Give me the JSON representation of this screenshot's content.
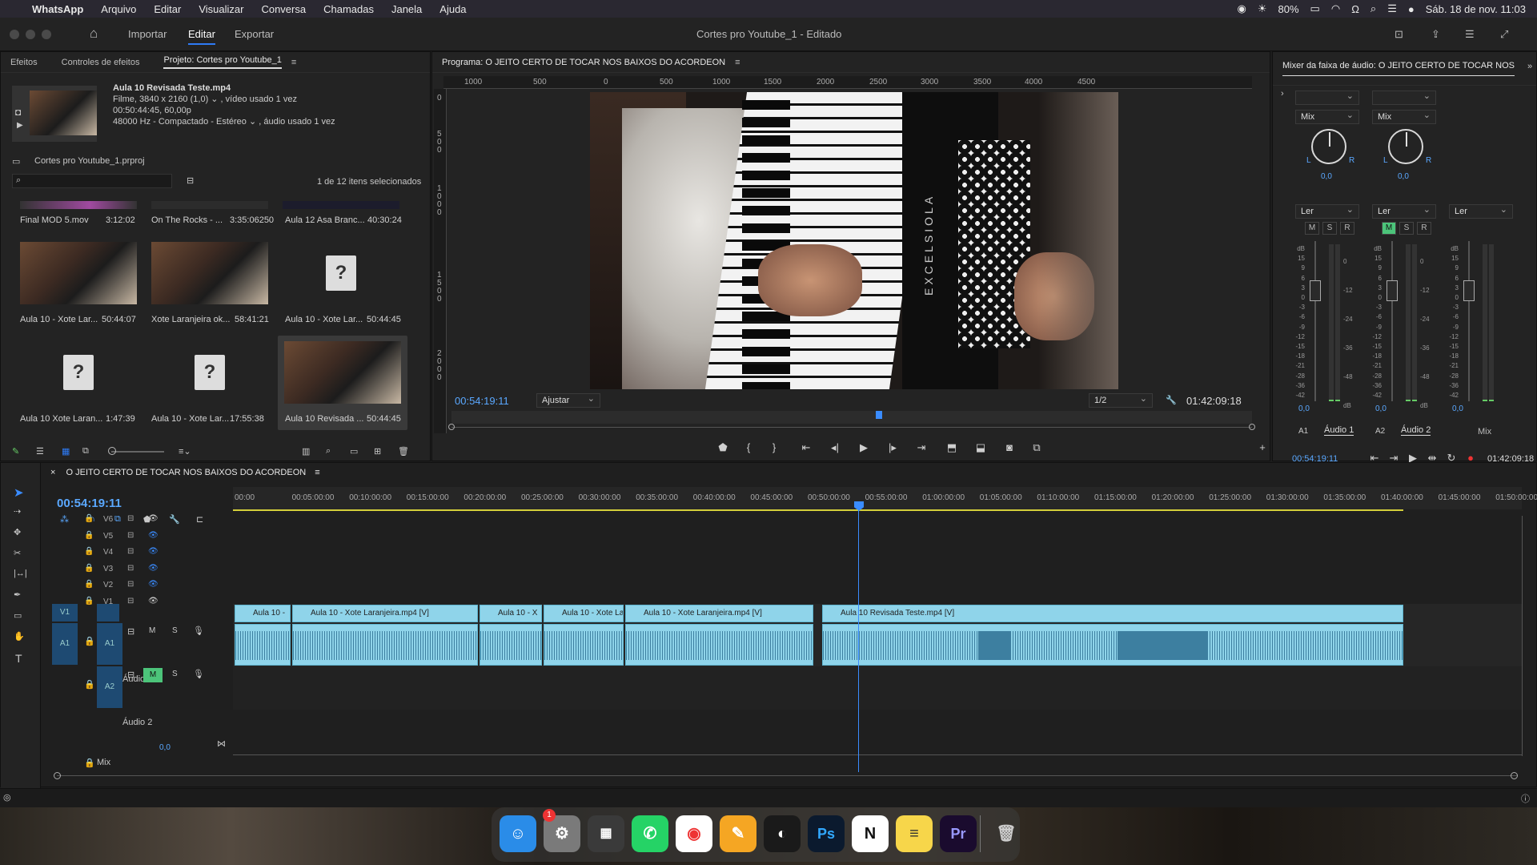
{
  "menubar": {
    "app": "WhatsApp",
    "items": [
      "Arquivo",
      "Editar",
      "Visualizar",
      "Conversa",
      "Chamadas",
      "Janela",
      "Ajuda"
    ],
    "battery": "80%",
    "datetime": "Sáb. 18 de nov.  11:03"
  },
  "appbar": {
    "tabs": [
      "Importar",
      "Editar",
      "Exportar"
    ],
    "active_tab": "Editar",
    "title": "Cortes pro Youtube_1 - Editado"
  },
  "project_panel": {
    "tabs": [
      "Efeitos",
      "Controles de efeitos",
      "Projeto: Cortes pro Youtube_1"
    ],
    "active_tab": "Projeto: Cortes pro Youtube_1",
    "clip_info": {
      "name": "Aula 10 Revisada Teste.mp4",
      "line1": "Filme, 3840 x 2160 (1,0) ⌄ , vídeo usado 1 vez",
      "line2": "00:50:44:45, 60,00p",
      "line3": "48000 Hz - Compactado - Estéreo ⌄ , áudio usado 1 vez"
    },
    "project_file": "Cortes pro Youtube_1.prproj",
    "selection_count": "1 de 12 itens selecionados",
    "top_row": [
      {
        "name": "Final MOD 5.mov",
        "duration": "3:12:02"
      },
      {
        "name": "On The Rocks - ...",
        "duration": "3:35:06250"
      },
      {
        "name": "Aula 12 Asa Branc...",
        "duration": "40:30:24"
      }
    ],
    "grid": [
      {
        "name": "Aula 10 - Xote Lar...",
        "duration": "50:44:07",
        "has_thumb": true
      },
      {
        "name": "Xote Laranjeira ok...",
        "duration": "58:41:21",
        "has_thumb": true
      },
      {
        "name": "Aula 10 - Xote Lar...",
        "duration": "50:44:45",
        "has_thumb": false
      },
      {
        "name": "Aula 10 Xote Laran...",
        "duration": "1:47:39",
        "has_thumb": false
      },
      {
        "name": "Aula 10 - Xote Lar...",
        "duration": "17:55:38",
        "has_thumb": false
      },
      {
        "name": "Aula 10 Revisada ...",
        "duration": "50:44:45",
        "has_thumb": true
      }
    ]
  },
  "program_monitor": {
    "title": "Programa: O JEITO CERTO DE TOCAR NOS BAIXOS DO ACORDEON",
    "ruler_ticks": [
      "1000",
      "500",
      "0",
      "500",
      "1000",
      "1500",
      "2000",
      "2500",
      "3000",
      "3500",
      "4000",
      "4500"
    ],
    "v_ruler_ticks": [
      "0",
      "5\n0\n0",
      "1\n0\n0\n0",
      "1\n5\n0\n0",
      "2\n0\n0\n0"
    ],
    "timecode": "00:54:19:11",
    "fit": "Ajustar",
    "resolution": "1/2",
    "duration": "01:42:09:18",
    "playhead_fraction": 0.53
  },
  "audio_mixer": {
    "title": "Mixer da faixa de áudio: O JEITO CERTO DE TOCAR NOS",
    "channels": [
      {
        "id": "A1",
        "name": "Áudio 1",
        "mode": "Mix",
        "automation": "Ler",
        "pan": "0,0",
        "level": "0,0",
        "mute_active": false
      },
      {
        "id": "A2",
        "name": "Áudio 2",
        "mode": "Mix",
        "automation": "Ler",
        "pan": "0,0",
        "level": "0,0",
        "mute_active": true
      },
      {
        "id": "",
        "name": "Mix",
        "mode": "",
        "automation": "Ler",
        "pan": "",
        "level": "0,0",
        "mute_active": false
      }
    ],
    "db_scale_left": [
      "dB",
      "15",
      "9",
      "6",
      "3",
      "0",
      "-3",
      "-6",
      "-9",
      "-12",
      "-15",
      "-18",
      "-21",
      "-28",
      "-36",
      "-42"
    ],
    "db_scale_right": [
      "0",
      "-12",
      "-24",
      "-36",
      "-48",
      "dB"
    ],
    "msr": [
      "M",
      "S",
      "R"
    ],
    "timecode": "00:54:19:11",
    "duration": "01:42:09:18"
  },
  "timeline": {
    "title": "O JEITO CERTO DE TOCAR NOS BAIXOS DO ACORDEON",
    "timecode": "00:54:19:11",
    "ruler": [
      "00:00",
      "00:05:00:00",
      "00:10:00:00",
      "00:15:00:00",
      "00:20:00:00",
      "00:25:00:00",
      "00:30:00:00",
      "00:35:00:00",
      "00:40:00:00",
      "00:45:00:00",
      "00:50:00:00",
      "00:55:00:00",
      "01:00:00:00",
      "01:05:00:00",
      "01:10:00:00",
      "01:15:00:00",
      "01:20:00:00",
      "01:25:00:00",
      "01:30:00:00",
      "01:35:00:00",
      "01:40:00:00",
      "01:45:00:00",
      "01:50:00:00"
    ],
    "video_tracks": [
      "V6",
      "V5",
      "V4",
      "V3",
      "V2",
      "V1"
    ],
    "audio_tracks": [
      {
        "id": "A1",
        "name": "Áudio 1"
      },
      {
        "id": "A2",
        "name": "Áudio 2"
      }
    ],
    "mix_label": "Mix",
    "mix_value": "0,0",
    "video_clips": [
      {
        "label": "Aula 10 -"
      },
      {
        "label": "Aula 10 - Xote Laranjeira.mp4 [V]"
      },
      {
        "label": "Aula 10 - X"
      },
      {
        "label": "Aula 10 - Xote La"
      },
      {
        "label": "Aula 10 - Xote Laranjeira.mp4 [V]"
      },
      {
        "label": "Aula 10 Revisada Teste.mp4 [V]"
      }
    ]
  },
  "dock": [
    "Finder",
    "Configurações",
    "Launchpad",
    "WhatsApp",
    "Chrome",
    "Pages",
    "OBS",
    "Ps",
    "Notion",
    "Notas",
    "Pr",
    "Lixo"
  ]
}
